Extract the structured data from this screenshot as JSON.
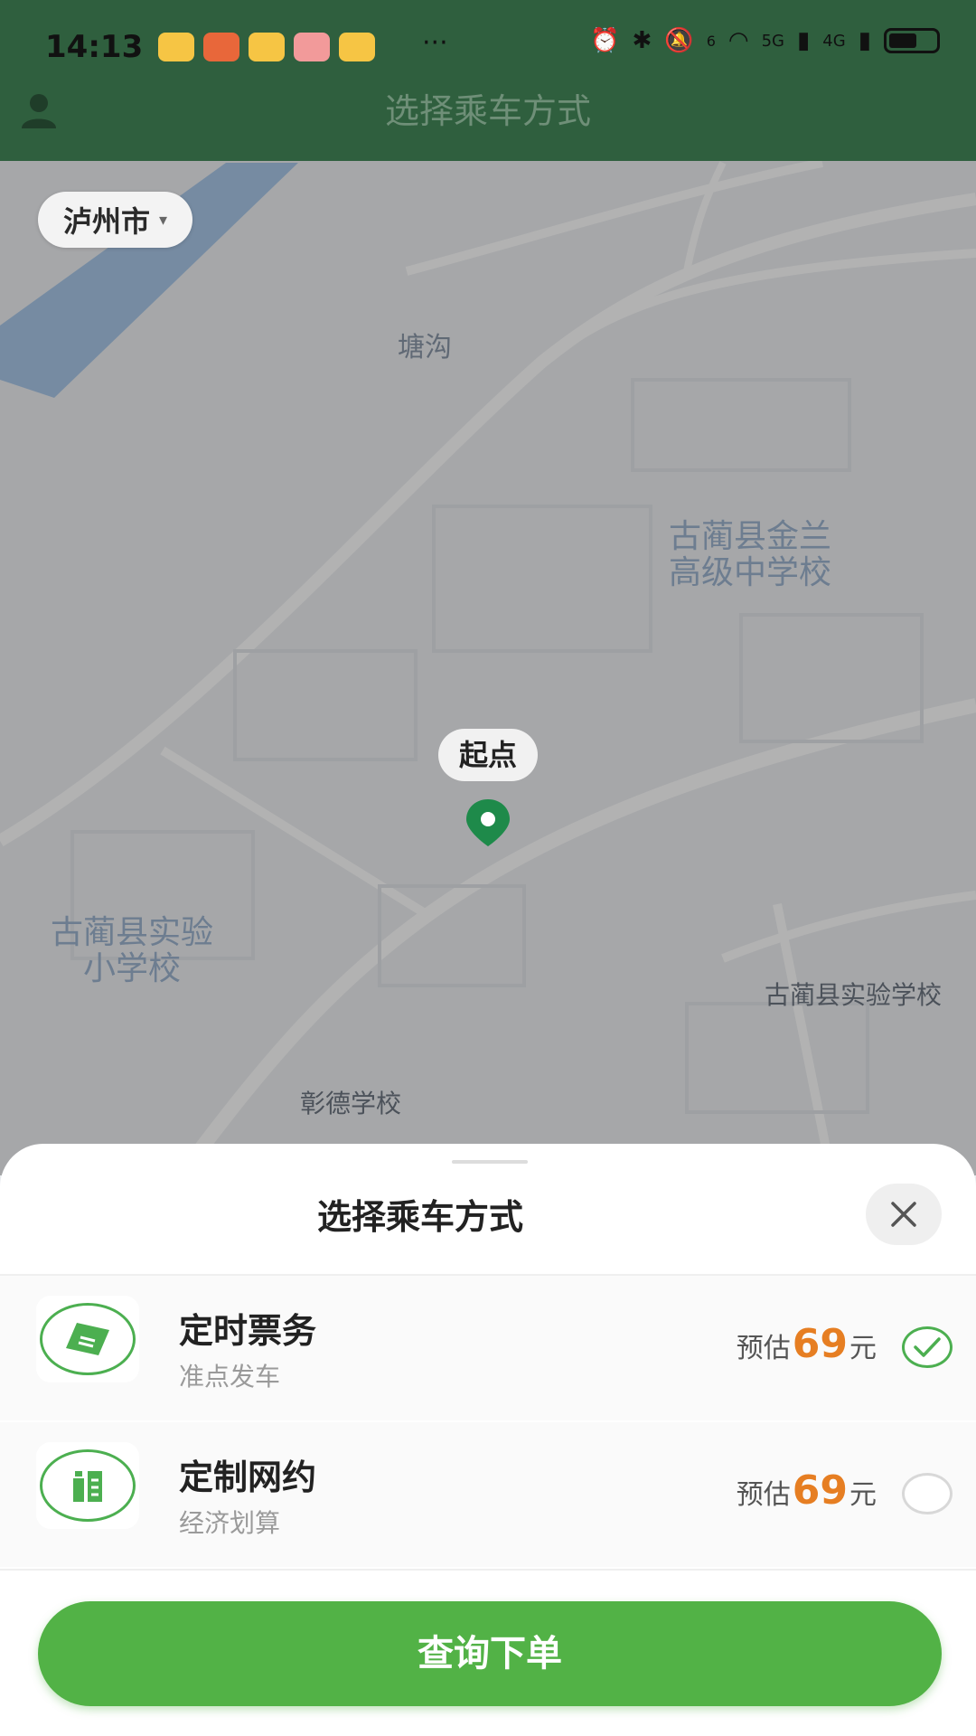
{
  "status_bar": {
    "time": "14:13",
    "more": "···",
    "net_6": "6",
    "net_5g": "5G",
    "net_4g": "4G"
  },
  "header": {
    "title": "选择乘车方式"
  },
  "map": {
    "city": "泸州市",
    "labels": {
      "place1": "塘沟",
      "school1": "古蔺县金兰\n高级中学校",
      "school2": "古蔺县实验\n小学校",
      "school3": "古蔺县实验学校",
      "school4": "彰德学校"
    },
    "start_label": "起点"
  },
  "sheet": {
    "title": "选择乘车方式",
    "options": [
      {
        "name": "定时票务",
        "sub": "准点发车",
        "prefix": "预估",
        "price": "69",
        "unit": "元",
        "selected": true
      },
      {
        "name": "定制网约",
        "sub": "经济划算",
        "prefix": "预估",
        "price": "69",
        "unit": "元",
        "selected": false
      }
    ],
    "submit": "查询下单"
  },
  "colors": {
    "brand_green": "#52b246",
    "header_green": "#2f5f3e",
    "price_orange": "#e67e22"
  }
}
